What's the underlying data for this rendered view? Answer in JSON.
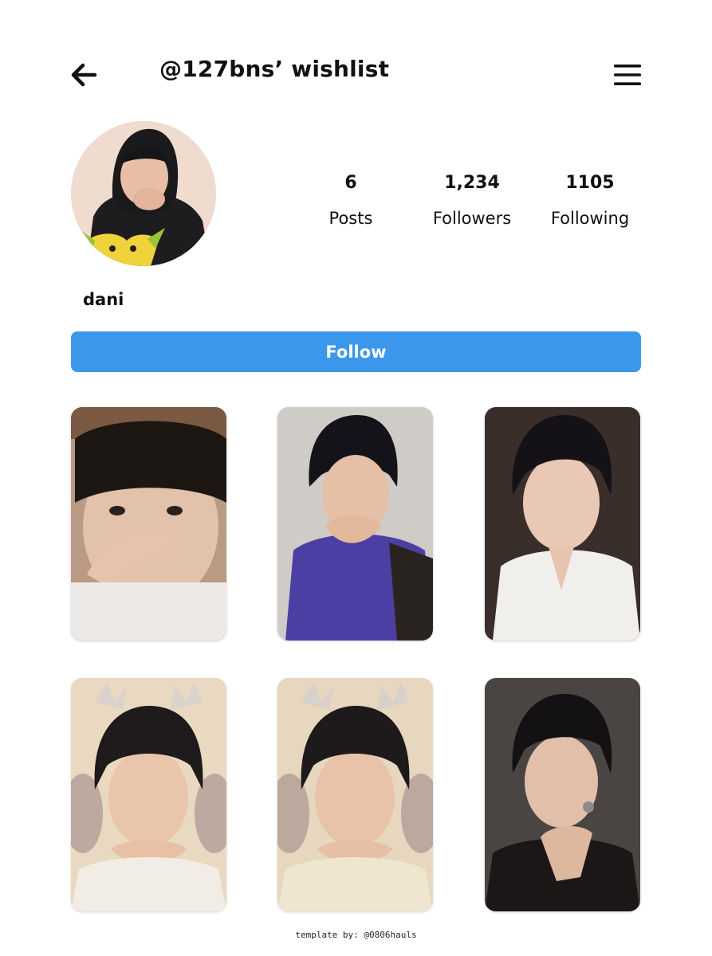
{
  "header": {
    "title": "@127bns’ wishlist",
    "back_icon": "arrow-left-icon",
    "menu_icon": "hamburger-menu-icon"
  },
  "profile": {
    "avatar": "profile-photo",
    "username": "dani",
    "stats": [
      {
        "value": "6",
        "label": "Posts"
      },
      {
        "value": "1,234",
        "label": "Followers"
      },
      {
        "value": "1105",
        "label": "Following"
      }
    ]
  },
  "follow_button": {
    "label": "Follow",
    "color": "#3b97ec"
  },
  "grid": {
    "posts": [
      {
        "description": "photocard"
      },
      {
        "description": "photocard"
      },
      {
        "description": "photocard"
      },
      {
        "description": "photocard"
      },
      {
        "description": "photocard"
      },
      {
        "description": "photocard"
      }
    ]
  },
  "footer": {
    "credit": "template by: @0806hauls"
  }
}
